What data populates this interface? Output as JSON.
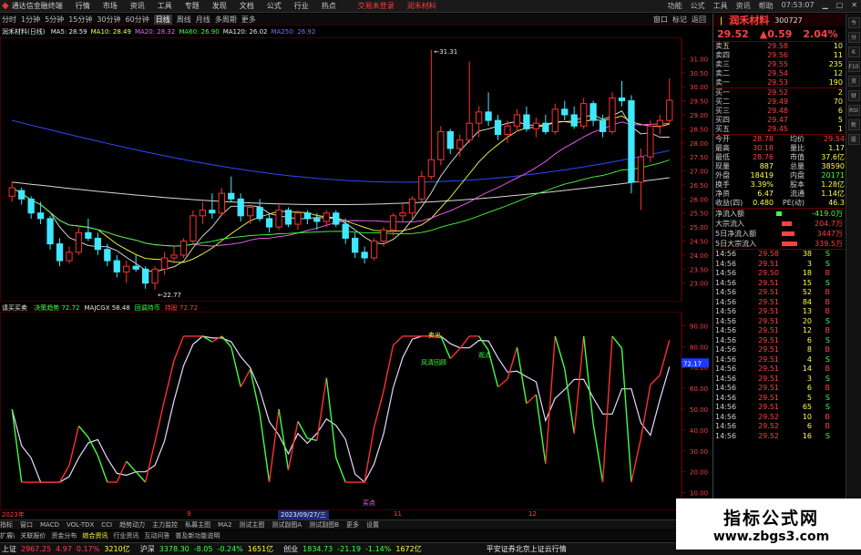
{
  "app": {
    "logo_icon": "app-logo-icon",
    "title": "通达信金融终端",
    "menu": [
      "行情",
      "市场",
      "资讯",
      "工具",
      "专题",
      "发现",
      "文档",
      "公式",
      "行业",
      "热点"
    ],
    "login_prompt": "交易未登录",
    "brand": "润禾材料",
    "right_buttons": [
      "功能",
      "公式",
      "工具",
      "资讯",
      "帮助"
    ],
    "clock": "07:53:07",
    "window_controls": [
      "minimize-icon",
      "maximize-icon",
      "close-icon"
    ]
  },
  "toolbar": {
    "periods": [
      "分时",
      "1分钟",
      "5分钟",
      "15分钟",
      "30分钟",
      "60分钟",
      "日线",
      "周线",
      "月线",
      "多周期",
      "更多"
    ],
    "active": "日线",
    "right": [
      "窗口",
      "标记",
      "返回"
    ]
  },
  "ma": {
    "name": "润禾材料(日线)",
    "items": [
      {
        "label": "MA5: 28.59",
        "color": "#e8e8e8"
      },
      {
        "label": "MA10: 28.49",
        "color": "#ffff40"
      },
      {
        "label": "MA20: 28.32",
        "color": "#ff60ff"
      },
      {
        "label": "MA60: 26.90",
        "color": "#40ff40"
      },
      {
        "label": "MA120: 26.02",
        "color": "#e8e8e8"
      },
      {
        "label": "MA250: 26.92",
        "color": "#6a7aff"
      }
    ]
  },
  "price_axis": [
    "31.00",
    "30.50",
    "30.00",
    "29.50",
    "29.00",
    "28.50",
    "28.00",
    "27.50",
    "27.00",
    "26.50",
    "26.00",
    "25.50",
    "25.00",
    "24.50",
    "24.00",
    "23.50",
    "23.00"
  ],
  "price_markers": {
    "high": "31.31",
    "low": "22.77"
  },
  "sub": {
    "title": "请买买卖",
    "items": [
      {
        "label": "决策趋势",
        "value": "72.72",
        "color": "#40ff40"
      },
      {
        "label": "MAJCGX",
        "value": "58.48",
        "color": "#e8e8e8"
      },
      {
        "label": "回调持币",
        "value": "",
        "color": "#40ff40"
      },
      {
        "label": "持股",
        "value": "72.72",
        "color": "#ff4040"
      }
    ],
    "axis": [
      "90.00",
      "80.00",
      "70.00",
      "60.00",
      "50.00",
      "40.00",
      "30.00",
      "20.00",
      "10.00"
    ],
    "marker": "72.17",
    "annotations": [
      {
        "text": "卖出",
        "color": "#ffff40"
      },
      {
        "text": "风清回顾",
        "color": "#40ff40"
      },
      {
        "text": "观点",
        "color": "#40ff40"
      },
      {
        "text": "买点",
        "color": "#ff60ff"
      }
    ]
  },
  "dates": {
    "start": "2023年",
    "mid": "9",
    "selected": "2023/09/27/三",
    "m11": "11",
    "m12": "12"
  },
  "chart_data": {
    "type": "candlestick",
    "ohlc": [
      [
        26.1,
        26.6,
        25.9,
        26.4
      ],
      [
        26.3,
        26.4,
        25.8,
        26.0
      ],
      [
        26.0,
        26.1,
        25.3,
        25.5
      ],
      [
        25.5,
        25.9,
        25.1,
        25.3
      ],
      [
        25.3,
        25.4,
        24.2,
        24.4
      ],
      [
        24.4,
        24.6,
        23.6,
        23.8
      ],
      [
        23.8,
        24.3,
        23.7,
        24.1
      ],
      [
        24.1,
        25.0,
        24.0,
        24.8
      ],
      [
        24.8,
        25.3,
        24.5,
        24.6
      ],
      [
        24.6,
        24.8,
        24.0,
        24.2
      ],
      [
        24.2,
        24.4,
        23.6,
        23.8
      ],
      [
        23.8,
        24.0,
        23.2,
        23.4
      ],
      [
        23.4,
        23.8,
        23.0,
        23.6
      ],
      [
        23.6,
        24.0,
        23.4,
        23.5
      ],
      [
        23.5,
        23.6,
        22.8,
        23.0
      ],
      [
        23.0,
        23.6,
        22.77,
        23.5
      ],
      [
        23.5,
        24.1,
        23.3,
        23.9
      ],
      [
        23.9,
        24.3,
        23.7,
        24.0
      ],
      [
        24.0,
        24.6,
        23.9,
        24.5
      ],
      [
        24.5,
        25.6,
        24.4,
        25.4
      ],
      [
        25.4,
        25.9,
        25.1,
        25.6
      ],
      [
        25.6,
        26.2,
        25.3,
        25.5
      ],
      [
        25.5,
        26.4,
        25.4,
        26.2
      ],
      [
        26.2,
        26.8,
        25.9,
        26.0
      ],
      [
        26.0,
        26.2,
        25.2,
        25.4
      ],
      [
        25.4,
        25.8,
        25.1,
        25.7
      ],
      [
        25.7,
        26.0,
        25.2,
        25.3
      ],
      [
        25.3,
        25.5,
        24.8,
        25.0
      ],
      [
        25.0,
        25.8,
        24.9,
        25.6
      ],
      [
        25.6,
        25.7,
        25.0,
        25.1
      ],
      [
        25.1,
        25.6,
        24.9,
        25.5
      ],
      [
        25.5,
        25.6,
        25.1,
        25.3
      ],
      [
        25.3,
        25.5,
        24.9,
        25.2
      ],
      [
        25.2,
        25.6,
        25.0,
        25.5
      ],
      [
        25.5,
        25.6,
        25.0,
        25.1
      ],
      [
        25.1,
        25.3,
        24.4,
        24.6
      ],
      [
        24.6,
        24.8,
        23.9,
        24.1
      ],
      [
        24.1,
        24.3,
        23.7,
        23.9
      ],
      [
        23.9,
        24.6,
        23.8,
        24.5
      ],
      [
        24.5,
        25.0,
        24.3,
        24.9
      ],
      [
        24.9,
        25.5,
        24.7,
        25.4
      ],
      [
        25.4,
        25.8,
        25.2,
        25.5
      ],
      [
        25.5,
        26.1,
        25.3,
        26.0
      ],
      [
        26.0,
        27.0,
        25.9,
        26.8
      ],
      [
        26.8,
        31.31,
        26.7,
        27.4
      ],
      [
        27.4,
        28.6,
        27.2,
        28.4
      ],
      [
        28.4,
        28.5,
        27.6,
        27.8
      ],
      [
        27.8,
        28.3,
        27.5,
        28.1
      ],
      [
        28.1,
        30.9,
        28.0,
        28.7
      ],
      [
        28.7,
        29.3,
        28.2,
        29.1
      ],
      [
        29.1,
        29.8,
        28.6,
        28.8
      ],
      [
        28.8,
        29.0,
        28.1,
        28.3
      ],
      [
        28.3,
        28.8,
        28.0,
        28.6
      ],
      [
        28.6,
        29.2,
        28.4,
        29.0
      ],
      [
        29.0,
        29.3,
        28.4,
        28.5
      ],
      [
        28.5,
        28.9,
        28.2,
        28.7
      ],
      [
        28.7,
        29.0,
        28.3,
        28.4
      ],
      [
        28.4,
        29.4,
        28.3,
        29.2
      ],
      [
        29.2,
        29.5,
        28.8,
        29.0
      ],
      [
        29.0,
        29.3,
        28.5,
        28.6
      ],
      [
        28.6,
        29.6,
        28.5,
        29.4
      ],
      [
        29.4,
        29.5,
        28.6,
        28.8
      ],
      [
        28.8,
        29.0,
        28.2,
        28.4
      ],
      [
        28.4,
        29.8,
        28.3,
        29.6
      ],
      [
        29.6,
        30.2,
        29.3,
        29.5
      ],
      [
        29.5,
        29.7,
        26.2,
        26.6
      ],
      [
        26.6,
        27.8,
        25.6,
        27.5
      ],
      [
        27.5,
        28.8,
        27.3,
        28.6
      ],
      [
        28.6,
        29.0,
        28.3,
        28.8
      ],
      [
        28.8,
        30.3,
        28.7,
        29.52
      ]
    ]
  },
  "quote": {
    "code": "300727",
    "name": "润禾材料",
    "price": "29.52",
    "change": "0.59",
    "pct": "2.04%",
    "asks": [
      [
        "卖五",
        "29.58",
        "10"
      ],
      [
        "卖四",
        "29.56",
        "11"
      ],
      [
        "卖三",
        "29.55",
        "235"
      ],
      [
        "卖二",
        "29.54",
        "12"
      ],
      [
        "卖一",
        "29.53",
        "190"
      ]
    ],
    "bids": [
      [
        "买一",
        "29.52",
        "2"
      ],
      [
        "买二",
        "29.49",
        "70"
      ],
      [
        "买三",
        "29.48",
        "6"
      ],
      [
        "买四",
        "29.47",
        "5"
      ],
      [
        "买五",
        "29.45",
        "1"
      ]
    ],
    "stats": [
      [
        "今开",
        "28.78",
        "均价",
        "29.54"
      ],
      [
        "最高",
        "30.18",
        "量比",
        "1.17"
      ],
      [
        "最低",
        "28.76",
        "市值",
        "37.6亿"
      ],
      [
        "现量",
        "887",
        "总量",
        "38590"
      ],
      [
        "外盘",
        "18419",
        "内盘",
        "20171"
      ],
      [
        "换手",
        "3.39%",
        "股本",
        "1.28亿"
      ],
      [
        "净资",
        "6.47",
        "流通",
        "1.14亿"
      ],
      [
        "收益(四)",
        "0.480",
        "PE(动)",
        "46.3"
      ]
    ],
    "flows": [
      [
        "净流入额",
        "-419.0万",
        "#40ff40"
      ],
      [
        "大宗流入",
        "204.7万",
        "#ff4040"
      ],
      [
        "5日净流入额",
        "3447万",
        "#ff4040"
      ],
      [
        "5日大宗流入",
        "339.5万",
        "#ff4040"
      ]
    ],
    "ticks": [
      [
        "14:56",
        "29.58",
        "38",
        "S"
      ],
      [
        "14:56",
        "29.51",
        "3",
        "S"
      ],
      [
        "14:56",
        "29.50",
        "18",
        "B"
      ],
      [
        "14:56",
        "29.51",
        "15",
        "S"
      ],
      [
        "14:56",
        "29.51",
        "52",
        "B"
      ],
      [
        "14:56",
        "29.51",
        "84",
        "B"
      ],
      [
        "14:56",
        "29.51",
        "13",
        "B"
      ],
      [
        "14:56",
        "29.51",
        "20",
        "S"
      ],
      [
        "14:56",
        "29.51",
        "12",
        "B"
      ],
      [
        "14:56",
        "29.51",
        "6",
        "S"
      ],
      [
        "14:56",
        "29.51",
        "8",
        "B"
      ],
      [
        "14:56",
        "29.51",
        "4",
        "S"
      ],
      [
        "14:56",
        "29.51",
        "14",
        "B"
      ],
      [
        "14:56",
        "29.51",
        "3",
        "S"
      ],
      [
        "14:56",
        "29.51",
        "6",
        "B"
      ],
      [
        "14:56",
        "29.51",
        "5",
        "S"
      ],
      [
        "14:56",
        "29.51",
        "65",
        "S"
      ],
      [
        "14:56",
        "29.52",
        "10",
        "B"
      ],
      [
        "14:56",
        "29.52",
        "6",
        "B"
      ],
      [
        "14:56",
        "29.52",
        "16",
        "S"
      ]
    ]
  },
  "bottom_tabs": [
    "指标",
    "窗口",
    "MACD",
    "VOL-TDX",
    "CCI",
    "趋势动力",
    "主力监控",
    "私募主图",
    "MA2",
    "测试主图",
    "测试副图A",
    "测试副图B",
    "更多",
    "设置"
  ],
  "bottom_tabs2": [
    "扩展\\",
    "关联报价",
    "资金分布",
    "综合资讯",
    "行业资讯",
    "互动问答",
    "普及新功能说明"
  ],
  "status": {
    "sh": [
      "上证",
      "2967.25",
      "4.97",
      "0.17%",
      "3210亿"
    ],
    "sz": [
      "沪深",
      "3378.30",
      "-8.05",
      "-0.24%",
      "1651亿"
    ],
    "cy": [
      "创业",
      "1834.73",
      "-21.19",
      "-1.14%",
      "1672亿"
    ],
    "broker": "平安证券北京上证云行情"
  },
  "sidebar": [
    "今",
    "分",
    "K",
    "F10",
    "资",
    "财",
    "RSI",
    "新",
    "股"
  ],
  "watermark": {
    "line1": "指标公式网",
    "line2": "www.zbgs3.com"
  }
}
